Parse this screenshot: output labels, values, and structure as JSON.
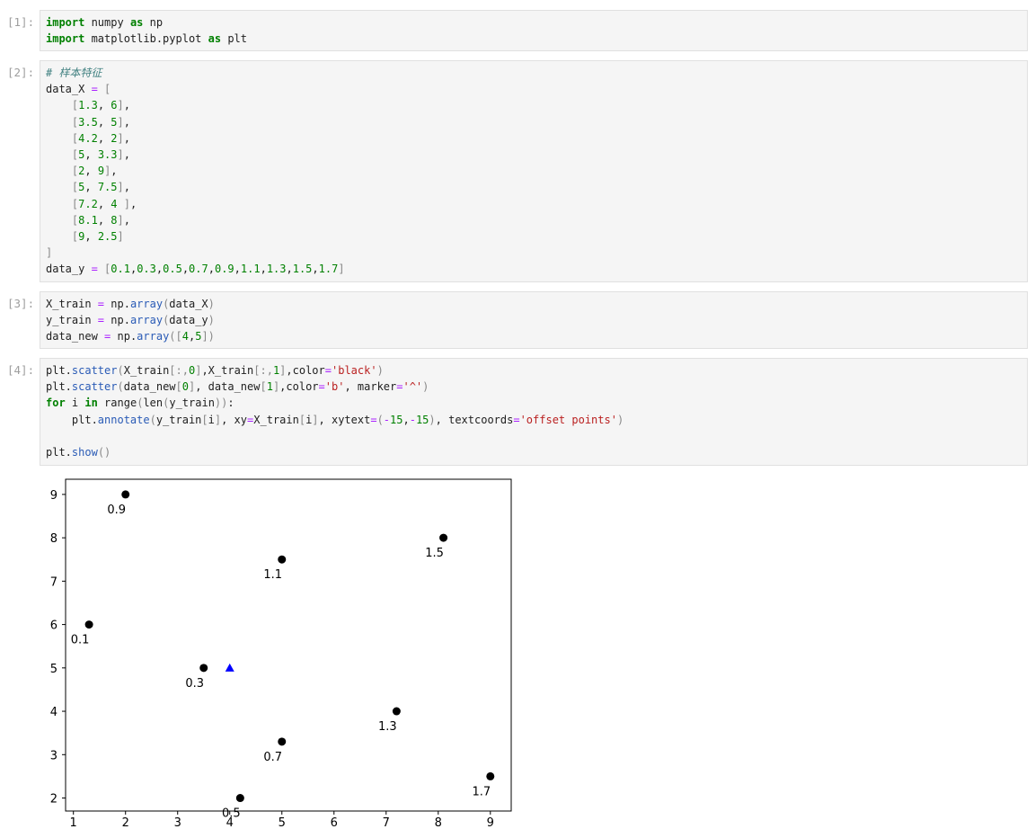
{
  "cells": [
    {
      "prompt": "[1]:",
      "lines": [
        [
          [
            "kw",
            "import"
          ],
          [
            "t",
            " numpy "
          ],
          [
            "kw",
            "as"
          ],
          [
            "t",
            " np"
          ]
        ],
        [
          [
            "kw",
            "import"
          ],
          [
            "t",
            " matplotlib.pyplot "
          ],
          [
            "kw",
            "as"
          ],
          [
            "t",
            " plt"
          ]
        ]
      ]
    },
    {
      "prompt": "[2]:",
      "lines": [
        [
          [
            "cm",
            "# 样本特征"
          ]
        ],
        [
          [
            "t",
            "data_X "
          ],
          [
            "op",
            "="
          ],
          [
            "t",
            " "
          ],
          [
            "br",
            "["
          ]
        ],
        [
          [
            "t",
            "    "
          ],
          [
            "br",
            "["
          ],
          [
            "num",
            "1.3"
          ],
          [
            "t",
            ", "
          ],
          [
            "num",
            "6"
          ],
          [
            "br",
            "]"
          ],
          [
            "t",
            ","
          ]
        ],
        [
          [
            "t",
            "    "
          ],
          [
            "br",
            "["
          ],
          [
            "num",
            "3.5"
          ],
          [
            "t",
            ", "
          ],
          [
            "num",
            "5"
          ],
          [
            "br",
            "]"
          ],
          [
            "t",
            ","
          ]
        ],
        [
          [
            "t",
            "    "
          ],
          [
            "br",
            "["
          ],
          [
            "num",
            "4.2"
          ],
          [
            "t",
            ", "
          ],
          [
            "num",
            "2"
          ],
          [
            "br",
            "]"
          ],
          [
            "t",
            ","
          ]
        ],
        [
          [
            "t",
            "    "
          ],
          [
            "br",
            "["
          ],
          [
            "num",
            "5"
          ],
          [
            "t",
            ", "
          ],
          [
            "num",
            "3.3"
          ],
          [
            "br",
            "]"
          ],
          [
            "t",
            ","
          ]
        ],
        [
          [
            "t",
            "    "
          ],
          [
            "br",
            "["
          ],
          [
            "num",
            "2"
          ],
          [
            "t",
            ", "
          ],
          [
            "num",
            "9"
          ],
          [
            "br",
            "]"
          ],
          [
            "t",
            ","
          ]
        ],
        [
          [
            "t",
            "    "
          ],
          [
            "br",
            "["
          ],
          [
            "num",
            "5"
          ],
          [
            "t",
            ", "
          ],
          [
            "num",
            "7.5"
          ],
          [
            "br",
            "]"
          ],
          [
            "t",
            ","
          ]
        ],
        [
          [
            "t",
            "    "
          ],
          [
            "br",
            "["
          ],
          [
            "num",
            "7.2"
          ],
          [
            "t",
            ", "
          ],
          [
            "num",
            "4"
          ],
          [
            "t",
            " "
          ],
          [
            "br",
            "]"
          ],
          [
            "t",
            ","
          ]
        ],
        [
          [
            "t",
            "    "
          ],
          [
            "br",
            "["
          ],
          [
            "num",
            "8.1"
          ],
          [
            "t",
            ", "
          ],
          [
            "num",
            "8"
          ],
          [
            "br",
            "]"
          ],
          [
            "t",
            ","
          ]
        ],
        [
          [
            "t",
            "    "
          ],
          [
            "br",
            "["
          ],
          [
            "num",
            "9"
          ],
          [
            "t",
            ", "
          ],
          [
            "num",
            "2.5"
          ],
          [
            "br",
            "]"
          ]
        ],
        [
          [
            "br",
            "]"
          ]
        ],
        [
          [
            "t",
            "data_y "
          ],
          [
            "op",
            "="
          ],
          [
            "t",
            " "
          ],
          [
            "br",
            "["
          ],
          [
            "num",
            "0.1"
          ],
          [
            "t",
            ","
          ],
          [
            "num",
            "0.3"
          ],
          [
            "t",
            ","
          ],
          [
            "num",
            "0.5"
          ],
          [
            "t",
            ","
          ],
          [
            "num",
            "0.7"
          ],
          [
            "t",
            ","
          ],
          [
            "num",
            "0.9"
          ],
          [
            "t",
            ","
          ],
          [
            "num",
            "1.1"
          ],
          [
            "t",
            ","
          ],
          [
            "num",
            "1.3"
          ],
          [
            "t",
            ","
          ],
          [
            "num",
            "1.5"
          ],
          [
            "t",
            ","
          ],
          [
            "num",
            "1.7"
          ],
          [
            "br",
            "]"
          ]
        ]
      ]
    },
    {
      "prompt": "[3]:",
      "lines": [
        [
          [
            "t",
            "X_train "
          ],
          [
            "op",
            "="
          ],
          [
            "t",
            " np."
          ],
          [
            "fn",
            "array"
          ],
          [
            "br",
            "("
          ],
          [
            "t",
            "data_X"
          ],
          [
            "br",
            ")"
          ]
        ],
        [
          [
            "t",
            "y_train "
          ],
          [
            "op",
            "="
          ],
          [
            "t",
            " np."
          ],
          [
            "fn",
            "array"
          ],
          [
            "br",
            "("
          ],
          [
            "t",
            "data_y"
          ],
          [
            "br",
            ")"
          ]
        ],
        [
          [
            "t",
            "data_new "
          ],
          [
            "op",
            "="
          ],
          [
            "t",
            " np."
          ],
          [
            "fn",
            "array"
          ],
          [
            "br",
            "(["
          ],
          [
            "num",
            "4"
          ],
          [
            "t",
            ","
          ],
          [
            "num",
            "5"
          ],
          [
            "br",
            "])"
          ]
        ]
      ]
    },
    {
      "prompt": "[4]:",
      "lines": [
        [
          [
            "t",
            "plt."
          ],
          [
            "fn",
            "scatter"
          ],
          [
            "br",
            "("
          ],
          [
            "t",
            "X_train"
          ],
          [
            "br",
            "[:,"
          ],
          [
            "num",
            "0"
          ],
          [
            "br",
            "]"
          ],
          [
            "t",
            ",X_train"
          ],
          [
            "br",
            "[:,"
          ],
          [
            "num",
            "1"
          ],
          [
            "br",
            "]"
          ],
          [
            "t",
            ",color"
          ],
          [
            "op",
            "="
          ],
          [
            "str",
            "'black'"
          ],
          [
            "br",
            ")"
          ]
        ],
        [
          [
            "t",
            "plt."
          ],
          [
            "fn",
            "scatter"
          ],
          [
            "br",
            "("
          ],
          [
            "t",
            "data_new"
          ],
          [
            "br",
            "["
          ],
          [
            "num",
            "0"
          ],
          [
            "br",
            "]"
          ],
          [
            "t",
            ", data_new"
          ],
          [
            "br",
            "["
          ],
          [
            "num",
            "1"
          ],
          [
            "br",
            "]"
          ],
          [
            "t",
            ",color"
          ],
          [
            "op",
            "="
          ],
          [
            "str",
            "'b'"
          ],
          [
            "t",
            ", marker"
          ],
          [
            "op",
            "="
          ],
          [
            "str",
            "'^'"
          ],
          [
            "br",
            ")"
          ]
        ],
        [
          [
            "kw",
            "for"
          ],
          [
            "t",
            " i "
          ],
          [
            "kw",
            "in"
          ],
          [
            "t",
            " range"
          ],
          [
            "br",
            "("
          ],
          [
            "t",
            "len"
          ],
          [
            "br",
            "("
          ],
          [
            "t",
            "y_train"
          ],
          [
            "br",
            "))"
          ],
          [
            "t",
            ":"
          ]
        ],
        [
          [
            "t",
            "    plt."
          ],
          [
            "fn",
            "annotate"
          ],
          [
            "br",
            "("
          ],
          [
            "t",
            "y_train"
          ],
          [
            "br",
            "["
          ],
          [
            "t",
            "i"
          ],
          [
            "br",
            "]"
          ],
          [
            "t",
            ", xy"
          ],
          [
            "op",
            "="
          ],
          [
            "t",
            "X_train"
          ],
          [
            "br",
            "["
          ],
          [
            "t",
            "i"
          ],
          [
            "br",
            "]"
          ],
          [
            "t",
            ", xytext"
          ],
          [
            "op",
            "="
          ],
          [
            "br",
            "("
          ],
          [
            "op",
            "-"
          ],
          [
            "num",
            "15"
          ],
          [
            "t",
            ","
          ],
          [
            "op",
            "-"
          ],
          [
            "num",
            "15"
          ],
          [
            "br",
            ")"
          ],
          [
            "t",
            ", textcoords"
          ],
          [
            "op",
            "="
          ],
          [
            "str",
            "'offset points'"
          ],
          [
            "br",
            ")"
          ]
        ],
        [
          [
            "t",
            ""
          ]
        ],
        [
          [
            "t",
            "plt."
          ],
          [
            "fn",
            "show"
          ],
          [
            "br",
            "()"
          ]
        ]
      ]
    }
  ],
  "colors": {
    "keyword": "#008000",
    "number": "#008000",
    "operator": "#aa22ff",
    "bracket": "#888888",
    "function": "#2a5bb6",
    "string": "#ba2121",
    "comment": "#408080"
  },
  "chart_data": {
    "type": "scatter",
    "title": "",
    "xlabel": "",
    "ylabel": "",
    "xlim": [
      0.85,
      9.4
    ],
    "ylim": [
      1.7,
      9.35
    ],
    "xticks": [
      1,
      2,
      3,
      4,
      5,
      6,
      7,
      8,
      9
    ],
    "yticks": [
      2,
      3,
      4,
      5,
      6,
      7,
      8,
      9
    ],
    "grid": false,
    "series": [
      {
        "marker": "circle",
        "color": "#000000",
        "points": [
          {
            "x": 1.3,
            "y": 6,
            "label": "0.1"
          },
          {
            "x": 3.5,
            "y": 5,
            "label": "0.3"
          },
          {
            "x": 4.2,
            "y": 2,
            "label": "0.5"
          },
          {
            "x": 5,
            "y": 3.3,
            "label": "0.7"
          },
          {
            "x": 2,
            "y": 9,
            "label": "0.9"
          },
          {
            "x": 5,
            "y": 7.5,
            "label": "1.1"
          },
          {
            "x": 7.2,
            "y": 4,
            "label": "1.3"
          },
          {
            "x": 8.1,
            "y": 8,
            "label": "1.5"
          },
          {
            "x": 9,
            "y": 2.5,
            "label": "1.7"
          }
        ]
      },
      {
        "marker": "triangle",
        "color": "#0000ff",
        "points": [
          {
            "x": 4,
            "y": 5
          }
        ]
      }
    ]
  }
}
